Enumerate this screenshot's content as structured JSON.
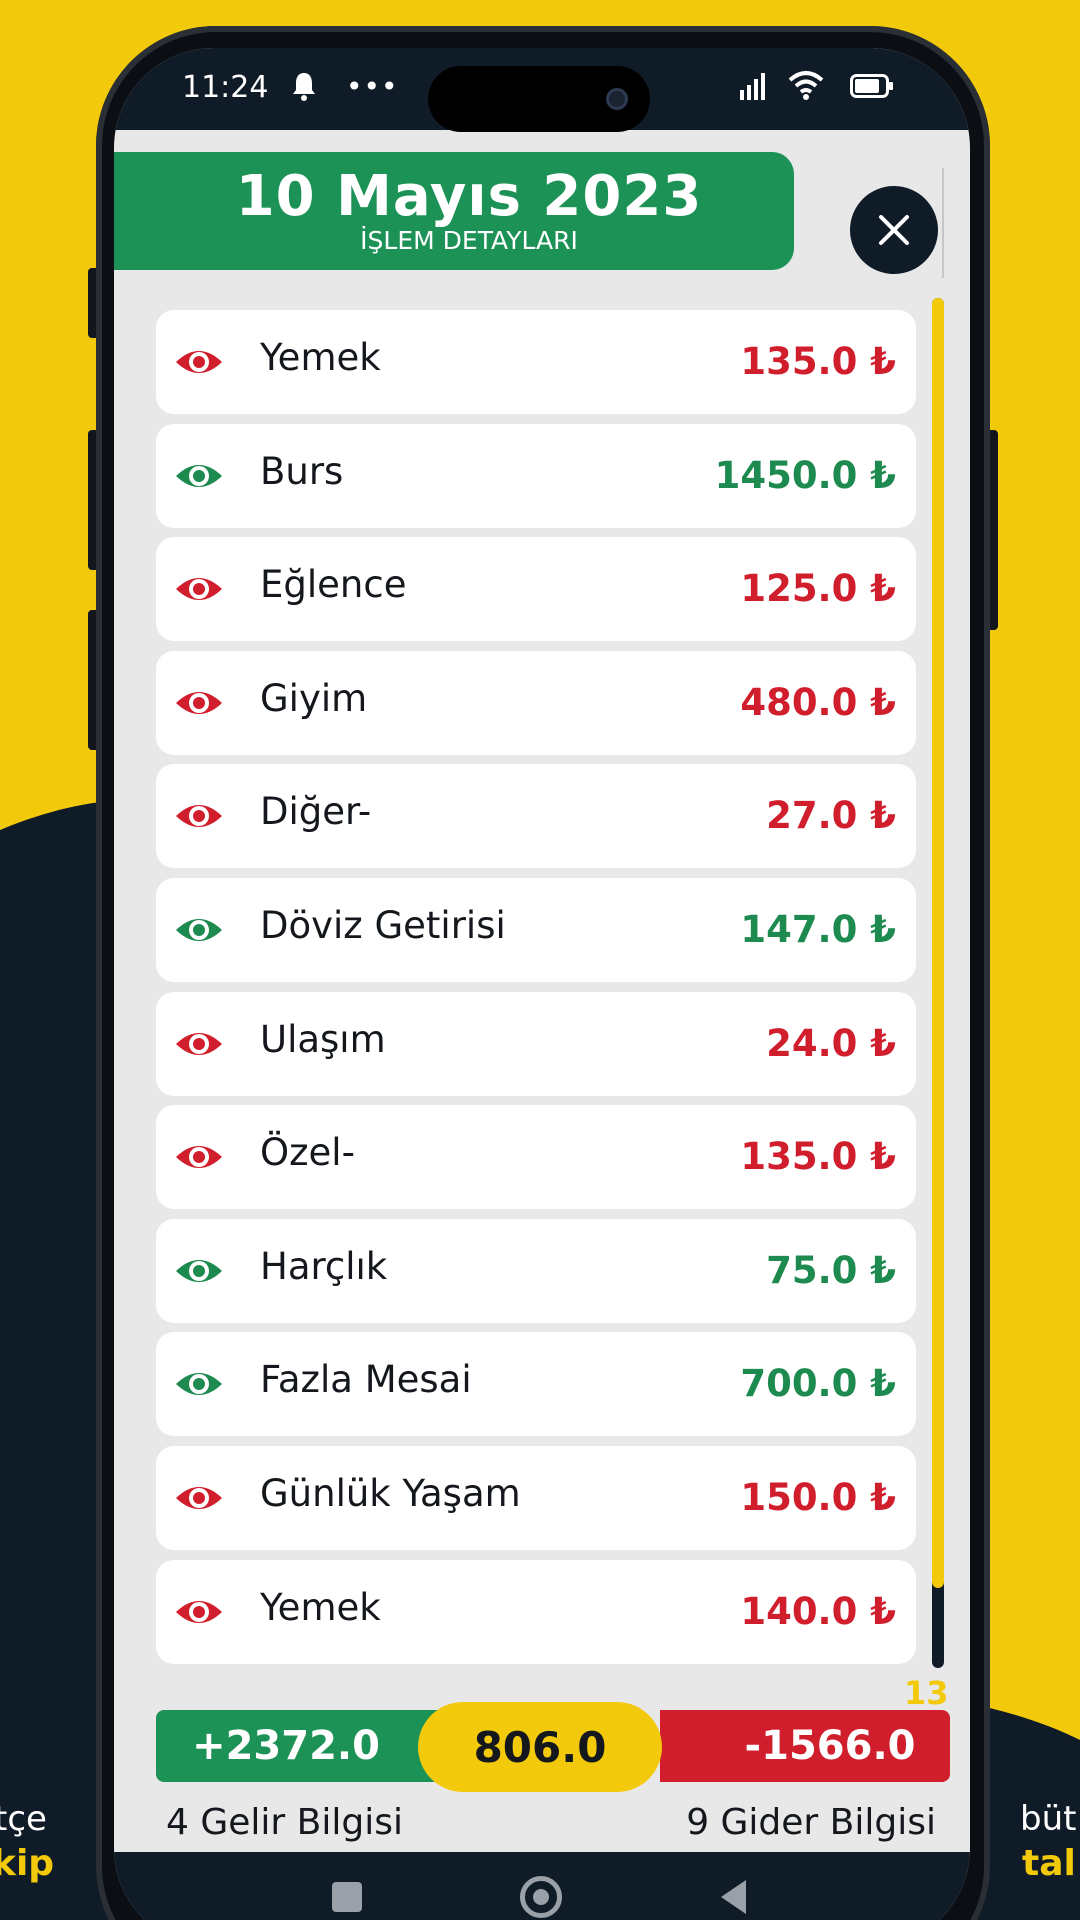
{
  "status_bar": {
    "time": "11:24",
    "notification_icon": "bell-icon",
    "more_icon": "•••"
  },
  "header": {
    "date": "10 Mayıs 2023",
    "subtitle": "İŞLEM DETAYLARI",
    "close_icon": "close-icon"
  },
  "transactions": [
    {
      "label": "Yemek",
      "amount": "135.0 ₺",
      "type": "expense"
    },
    {
      "label": "Burs",
      "amount": "1450.0 ₺",
      "type": "income"
    },
    {
      "label": "Eğlence",
      "amount": "125.0 ₺",
      "type": "expense"
    },
    {
      "label": "Giyim",
      "amount": "480.0 ₺",
      "type": "expense"
    },
    {
      "label": "Diğer-",
      "amount": "27.0 ₺",
      "type": "expense"
    },
    {
      "label": "Döviz Getirisi",
      "amount": "147.0 ₺",
      "type": "income"
    },
    {
      "label": "Ulaşım",
      "amount": "24.0 ₺",
      "type": "expense"
    },
    {
      "label": "Özel-",
      "amount": "135.0 ₺",
      "type": "expense"
    },
    {
      "label": "Harçlık",
      "amount": "75.0 ₺",
      "type": "income"
    },
    {
      "label": "Fazla Mesai",
      "amount": "700.0 ₺",
      "type": "income"
    },
    {
      "label": "Günlük Yaşam",
      "amount": "150.0 ₺",
      "type": "expense"
    },
    {
      "label": "Yemek",
      "amount": "140.0 ₺",
      "type": "expense"
    }
  ],
  "count": "13",
  "summary": {
    "income": "+2372.0",
    "net": "806.0",
    "expense": "-1566.0",
    "income_caption": "4 Gelir Bilgisi",
    "expense_caption": "9 Gider Bilgisi"
  },
  "background_text": {
    "left_top": "tçe",
    "left_bottom": "kip",
    "right_top": "büt",
    "right_bottom": "tal"
  },
  "colors": {
    "income": "#1d8a4f",
    "expense": "#d11e2d",
    "accent": "#f2c90b",
    "header_green": "#1d9257",
    "dark": "#0f1b26"
  }
}
